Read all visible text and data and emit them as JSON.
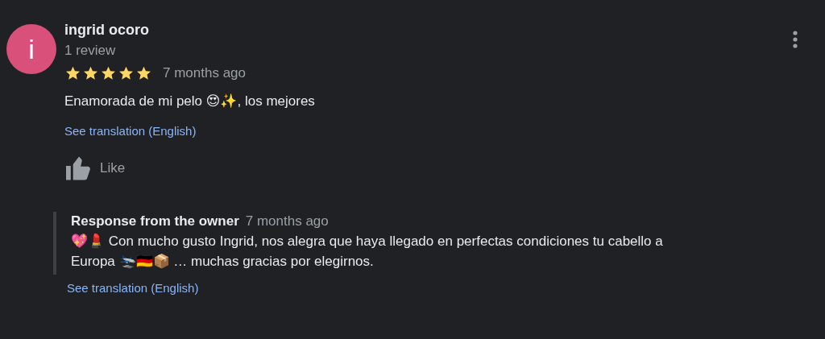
{
  "review": {
    "avatar_letter": "i",
    "author": "ingrid ocoro",
    "review_count": "1 review",
    "stars": 5,
    "time": "7 months ago",
    "text": "Enamorada de mi pelo 😍✨, los mejores",
    "translation_link": "See translation (English)",
    "like_label": "Like"
  },
  "owner_response": {
    "title": "Response from the owner",
    "time": "7 months ago",
    "text": "💖💄 Con mucho gusto Ingrid, nos alegra que haya llegado en perfectas condiciones tu cabello a Europa 🛬🇩🇪📦 … muchas gracias por elegirnos.",
    "translation_link": "See translation (English)"
  }
}
